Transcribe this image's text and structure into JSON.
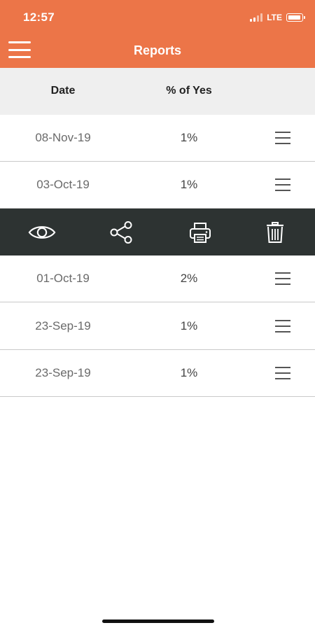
{
  "status_bar": {
    "time": "12:57",
    "network": "LTE"
  },
  "header": {
    "title": "Reports"
  },
  "table": {
    "columns": [
      "Date",
      "% of Yes"
    ],
    "rows": [
      {
        "date": "08-Nov-19",
        "percent": "1%"
      },
      {
        "date": "03-Oct-19",
        "percent": "1%"
      },
      {
        "date": "01-Oct-19",
        "percent": "2%"
      },
      {
        "date": "23-Sep-19",
        "percent": "1%"
      },
      {
        "date": "23-Sep-19",
        "percent": "1%"
      }
    ]
  },
  "action_bar": {
    "actions": [
      "eye-icon",
      "share-icon",
      "print-icon",
      "trash-icon"
    ]
  },
  "colors": {
    "header": "#ec7548",
    "action_bar": "#2d3332",
    "column_header": "#efefef"
  }
}
